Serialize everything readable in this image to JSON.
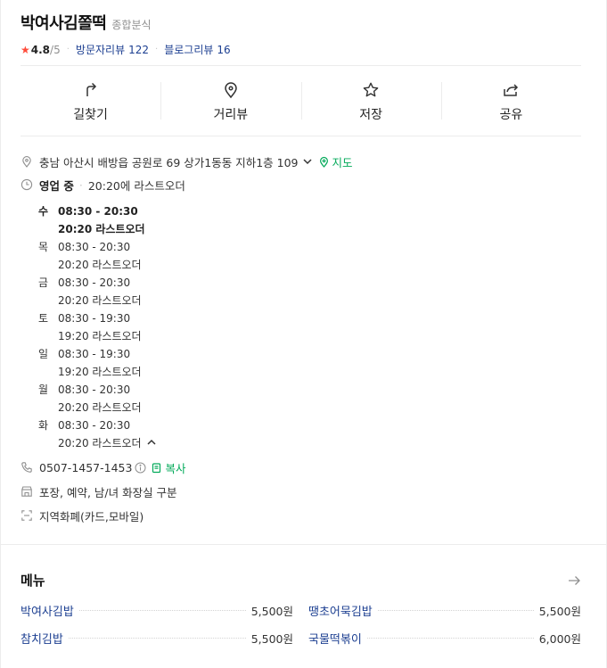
{
  "place": {
    "name": "박여사김쫄떡",
    "category": "종합분식",
    "rating": "4.8",
    "rating_scale": "/5",
    "visitor_review_label": "방문자리뷰",
    "visitor_review_count": "122",
    "blog_review_label": "블로그리뷰",
    "blog_review_count": "16"
  },
  "actions": [
    {
      "label": "길찾기",
      "icon": "directions-icon"
    },
    {
      "label": "거리뷰",
      "icon": "streetview-pin-icon"
    },
    {
      "label": "저장",
      "icon": "star-outline-icon"
    },
    {
      "label": "공유",
      "icon": "share-icon"
    }
  ],
  "info": {
    "address": "충남 아산시 배방읍 공원로 69 상가1동동 지하1층 109",
    "map_label": "지도",
    "status": "영업 중",
    "status_detail": "20:20에 라스트오더",
    "hours": [
      {
        "day": "수",
        "time": "08:30 - 20:30",
        "last_order": "20:20 라스트오더"
      },
      {
        "day": "목",
        "time": "08:30 - 20:30",
        "last_order": "20:20 라스트오더"
      },
      {
        "day": "금",
        "time": "08:30 - 20:30",
        "last_order": "20:20 라스트오더"
      },
      {
        "day": "토",
        "time": "08:30 - 19:30",
        "last_order": "19:20 라스트오더"
      },
      {
        "day": "일",
        "time": "08:30 - 19:30",
        "last_order": "19:20 라스트오더"
      },
      {
        "day": "월",
        "time": "08:30 - 20:30",
        "last_order": "20:20 라스트오더"
      },
      {
        "day": "화",
        "time": "08:30 - 20:30",
        "last_order": "20:20 라스트오더"
      }
    ],
    "phone": "0507-1457-1453",
    "copy_label": "복사",
    "facilities": "포장, 예약, 남/녀 화장실 구분",
    "payment": "지역화폐(카드,모바일)"
  },
  "menu": {
    "title": "메뉴",
    "items": [
      {
        "name": "박여사김밥",
        "price": "5,500원"
      },
      {
        "name": "땡초어묵김밥",
        "price": "5,500원"
      },
      {
        "name": "참치김밥",
        "price": "5,500원"
      },
      {
        "name": "국물떡볶이",
        "price": "6,000원"
      }
    ]
  },
  "colors": {
    "link_blue": "#1c3f91",
    "green": "#03aa5a",
    "star_red": "#ff4c3b"
  }
}
